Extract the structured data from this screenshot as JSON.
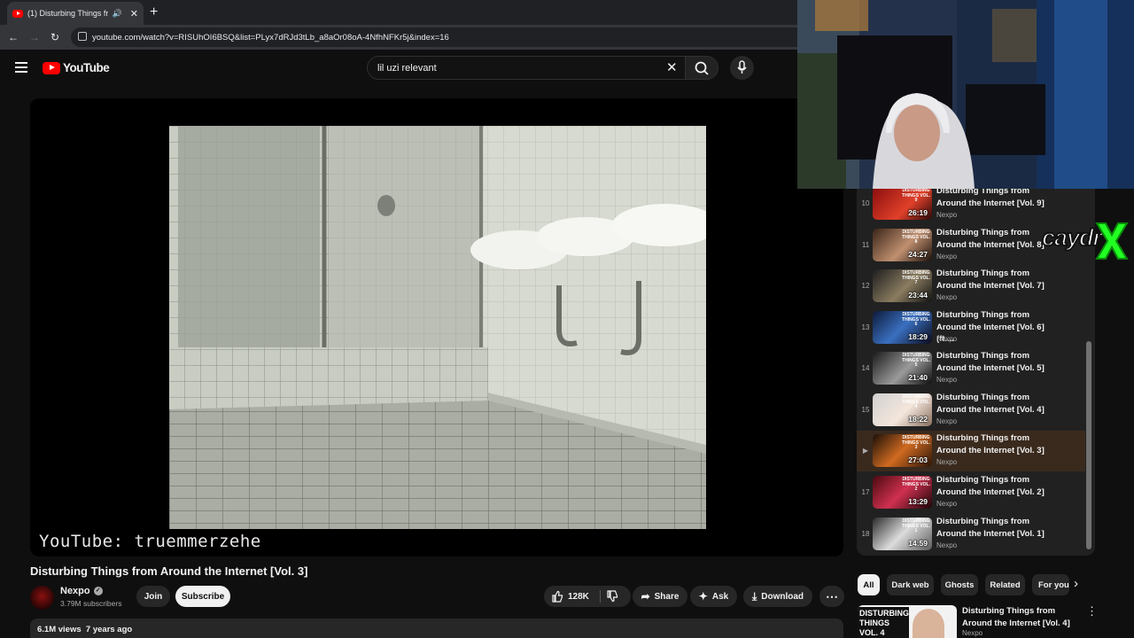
{
  "browser": {
    "tab_title": "(1) Disturbing Things from",
    "new_tab": "+",
    "url": "youtube.com/watch?v=RISUhOI6BSQ&list=PLyx7dRJd3tLb_a8aOr08oA-4NfhNFKr5j&index=16"
  },
  "header": {
    "logo_text": "YouTube",
    "search_value": "lil uzi relevant"
  },
  "video": {
    "watermark": "YouTube: truemmerzehe",
    "title": "Disturbing Things from Around the Internet [Vol. 3]"
  },
  "channel": {
    "name": "Nexpo",
    "subscribers": "3.79M subscribers",
    "join_label": "Join",
    "subscribe_label": "Subscribe"
  },
  "actions": {
    "likes": "128K",
    "share": "Share",
    "ask": "Ask",
    "download": "Download"
  },
  "description": {
    "meta": "6.1M views  7 years ago"
  },
  "playlist": {
    "items": [
      {
        "num": "10",
        "title": "Disturbing Things from Around the Internet [Vol. 9]",
        "channel": "Nexpo",
        "duration": "26:19",
        "thumb_label": "DISTURBING THINGS VOL. 9"
      },
      {
        "num": "11",
        "title": "Disturbing Things from Around the Internet [Vol. 8]",
        "channel": "Nexpo",
        "duration": "24:27",
        "thumb_label": "DISTURBING THINGS VOL. 8"
      },
      {
        "num": "12",
        "title": "Disturbing Things from Around the Internet [Vol. 7]",
        "channel": "Nexpo",
        "duration": "23:44",
        "thumb_label": "DISTURBING THINGS VOL. 7"
      },
      {
        "num": "13",
        "title": "Disturbing Things from Around the Internet [Vol. 6] (ft....",
        "channel": "Nexpo",
        "duration": "18:29",
        "thumb_label": "DISTURBING THINGS VOL. 6"
      },
      {
        "num": "14",
        "title": "Disturbing Things from Around the Internet [Vol. 5]",
        "channel": "Nexpo",
        "duration": "21:40",
        "thumb_label": "DISTURBING THINGS VOL. 5"
      },
      {
        "num": "15",
        "title": "Disturbing Things from Around the Internet [Vol. 4]",
        "channel": "Nexpo",
        "duration": "18:22",
        "thumb_label": "DISTURBING THINGS VOL. 4"
      },
      {
        "num": "▶",
        "title": "Disturbing Things from Around the Internet [Vol. 3]",
        "channel": "Nexpo",
        "duration": "27:03",
        "thumb_label": "DISTURBING THINGS VOL. 3"
      },
      {
        "num": "17",
        "title": "Disturbing Things from Around the Internet [Vol. 2]",
        "channel": "Nexpo",
        "duration": "13:29",
        "thumb_label": "DISTURBING THINGS VOL. 2"
      },
      {
        "num": "18",
        "title": "Disturbing Things from Around the Internet [Vol. 1]",
        "channel": "Nexpo",
        "duration": "14:59",
        "thumb_label": "DISTURBING THINGS VOL. 1"
      }
    ]
  },
  "chips": [
    "All",
    "Dark web",
    "Ghosts",
    "Related",
    "For you"
  ],
  "recommendation": {
    "title": "Disturbing Things from Around the Internet [Vol. 4]",
    "channel": "Nexpo",
    "thumb_text": "DISTURBING THINGS VOL. 4"
  },
  "overlay": {
    "streamer_logo": "caydr"
  },
  "colors": {
    "background": "#0f0f0f",
    "brand_red": "#ff0000",
    "active_item": "#3a2a1e",
    "overlay_green": "#22ff22"
  }
}
